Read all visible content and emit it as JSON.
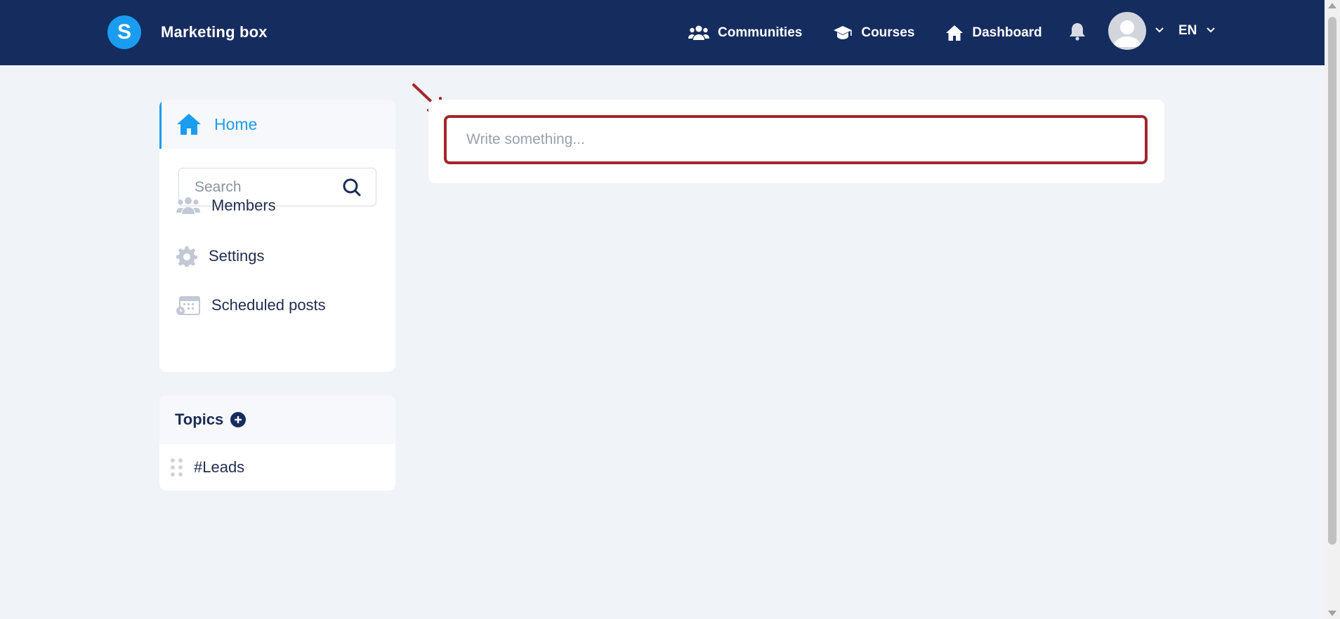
{
  "header": {
    "brand_letter": "S",
    "brand_name": "Marketing box",
    "nav": [
      {
        "label": "Communities",
        "icon": "users-icon"
      },
      {
        "label": "Courses",
        "icon": "graduation-cap-icon"
      },
      {
        "label": "Dashboard",
        "icon": "home-icon"
      }
    ],
    "language": "EN"
  },
  "sidebar": {
    "home_label": "Home",
    "search_placeholder": "Search",
    "items": [
      {
        "label": "Members",
        "icon": "members-icon"
      },
      {
        "label": "Settings",
        "icon": "gear-icon"
      },
      {
        "label": "Scheduled posts",
        "icon": "calendar-clock-icon"
      }
    ]
  },
  "topics": {
    "title": "Topics",
    "items": [
      {
        "label": "#Leads"
      }
    ]
  },
  "composer": {
    "placeholder": "Write something..."
  },
  "colors": {
    "header_bg": "#152c5f",
    "accent": "#1a9cf0",
    "highlight_border": "#a3262a",
    "page_bg": "#f0f3f8"
  }
}
